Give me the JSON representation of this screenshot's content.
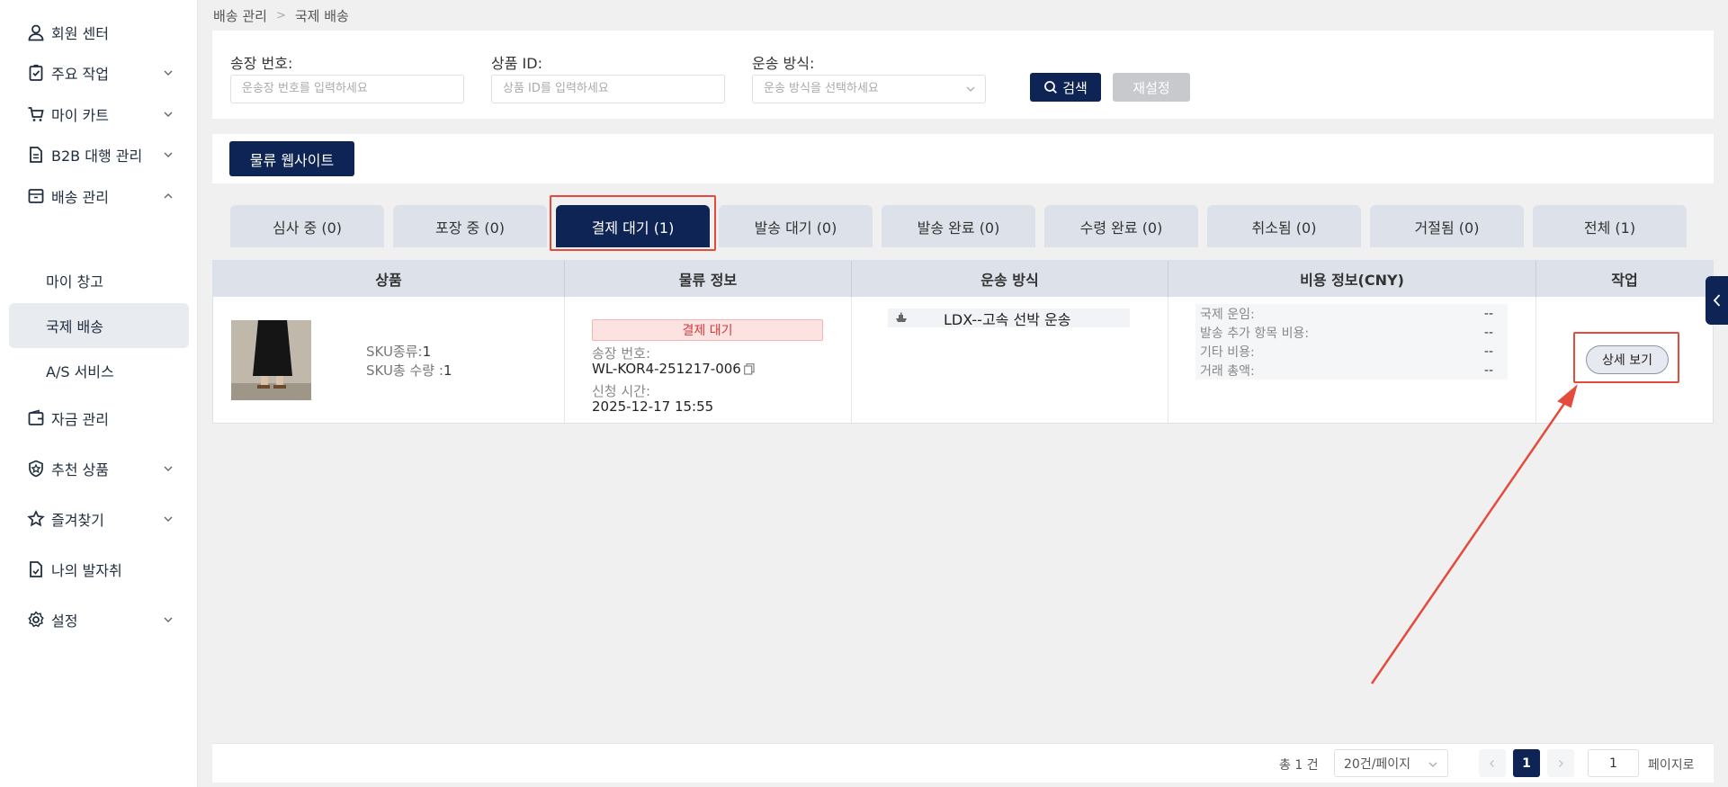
{
  "sidebar": {
    "items": [
      {
        "label": "회원 센터",
        "icon": "user-icon",
        "has_chevron": false
      },
      {
        "label": "주요 작업",
        "icon": "clipboard-check-icon",
        "has_chevron": true
      },
      {
        "label": "마이 카트",
        "icon": "cart-icon",
        "has_chevron": true
      },
      {
        "label": "B2B 대행 관리",
        "icon": "document-icon",
        "has_chevron": true
      },
      {
        "label": "배송 관리",
        "icon": "box-icon",
        "has_chevron": true,
        "expanded": true
      },
      {
        "label": "자금 관리",
        "icon": "wallet-icon",
        "has_chevron": false
      },
      {
        "label": "추천 상품",
        "icon": "star-badge-icon",
        "has_chevron": true
      },
      {
        "label": "즐겨찾기",
        "icon": "star-icon",
        "has_chevron": true
      },
      {
        "label": "나의 발자취",
        "icon": "footprint-icon",
        "has_chevron": false
      },
      {
        "label": "설정",
        "icon": "gear-icon",
        "has_chevron": true
      }
    ],
    "subitems": [
      {
        "label": "마이 창고",
        "active": false
      },
      {
        "label": "국제 배송",
        "active": true
      },
      {
        "label": "A/S 서비스",
        "active": false
      }
    ]
  },
  "breadcrumb": {
    "parent": "배송 관리",
    "separator": ">",
    "current": "국제 배송"
  },
  "filter": {
    "invoice_label": "송장 번호:",
    "invoice_placeholder": "운송장 번호를 입력하세요",
    "product_label": "상품 ID:",
    "product_placeholder": "상품 ID를 입력하세요",
    "method_label": "운송 방식:",
    "method_placeholder": "운송 방식을 선택하세요",
    "search_label": "검색",
    "reset_label": "재설정"
  },
  "logistics_button": "물류 웹사이트",
  "tabs": [
    {
      "label": "심사 중 (0)",
      "active": false
    },
    {
      "label": "포장 중 (0)",
      "active": false
    },
    {
      "label": "결제 대기 (1)",
      "active": true
    },
    {
      "label": "발송 대기 (0)",
      "active": false
    },
    {
      "label": "발송 완료 (0)",
      "active": false
    },
    {
      "label": "수령 완료 (0)",
      "active": false
    },
    {
      "label": "취소됨 (0)",
      "active": false
    },
    {
      "label": "거절됨 (0)",
      "active": false
    },
    {
      "label": "전체 (1)",
      "active": false
    }
  ],
  "table": {
    "headers": [
      "상품",
      "물류 정보",
      "운송 방식",
      "비용 정보(CNY)",
      "작업"
    ],
    "row": {
      "sku_type_label": "SKU종류:",
      "sku_type_value": "1",
      "sku_qty_label": "SKU총 수량 :",
      "sku_qty_value": "1",
      "status": "결제 대기",
      "invoice_label": "송장 번호:",
      "invoice_value": "WL-KOR4-251217-006",
      "apply_label": "신청 시간:",
      "apply_value": "2025-12-17 15:55",
      "shipping_method": "LDX--고속 선박 운송",
      "costs": [
        {
          "label": "국제 운임:",
          "value": "--"
        },
        {
          "label": "발송 추가 항목 비용:",
          "value": "--"
        },
        {
          "label": "기타 비용:",
          "value": "--"
        },
        {
          "label": "거래 총액:",
          "value": "--"
        }
      ],
      "action_label": "상세 보기"
    }
  },
  "pagination": {
    "total": "총 1 건",
    "page_size": "20건/페이지",
    "current_page": "1",
    "goto_value": "1",
    "goto_label": "페이지로"
  },
  "colors": {
    "primary": "#0e2454",
    "highlight": "#e54b3c",
    "status_bg": "#fde2e2",
    "status_text": "#d23a3a"
  }
}
